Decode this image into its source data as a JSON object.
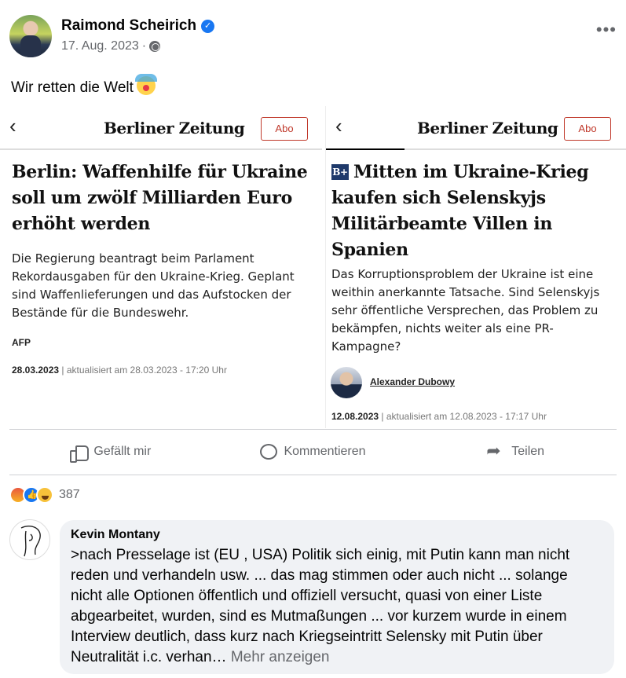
{
  "post": {
    "author": "Raimond Scheirich",
    "date": "17. Aug. 2023",
    "separator": "·",
    "text": "Wir retten die Welt"
  },
  "article_left": {
    "logo": "Berliner Zeitung",
    "abo": "Abo",
    "headline": "Berlin: Waffenhilfe für Ukraine soll um zwölf Milliarden Euro erhöht werden",
    "lede": "Die Regierung beantragt beim Parlament Rekordausgaben für den Ukraine-Krieg. Geplant sind Waffenlieferungen und das Aufstocken der Bestände für die Bundeswehr.",
    "source": "AFP",
    "date": "28.03.2023",
    "updated": "| aktualisiert am 28.03.2023 - 17:20 Uhr"
  },
  "article_right": {
    "logo": "Berliner Zeitung",
    "abo": "Abo",
    "badge": "B+",
    "headline": "Mitten im Ukraine-Krieg kaufen sich Selenskyjs Militärbeamte Villen in Spanien",
    "lede": "Das Korruptionsproblem der Ukraine ist eine weithin anerkannte Tatsache. Sind Selenskyjs sehr öffentliche Versprechen, das Problem zu bekämpfen, nichts weiter als eine PR-Kampagne?",
    "author": "Alexander Dubowy",
    "date": "12.08.2023",
    "updated": "| aktualisiert am 12.08.2023 - 17:17 Uhr"
  },
  "actions": {
    "like": "Gefällt mir",
    "comment": "Kommentieren",
    "share": "Teilen"
  },
  "reactions": {
    "count": "387",
    "types": [
      "angry",
      "like",
      "haha"
    ]
  },
  "comment": {
    "author": "Kevin Montany",
    "text": ">nach Presselage ist (EU , USA) Politik sich einig, mit Putin kann man nicht reden und  verhandeln  usw. ... das mag stimmen oder auch nicht ... solange nicht alle Optionen öffentlich und offiziell versucht, quasi von einer Liste abgearbeitet, wurden, sind es  Mutmaßungen ... vor kurzem wurde in einem Interview deutlich, dass kurz nach Kriegseintritt Selensky mit Putin über Neutralität i.c. verhan…",
    "more": "Mehr anzeigen"
  },
  "colors": {
    "facebook_blue": "#1877f2",
    "muted_text": "#65676b",
    "bubble_bg": "#f0f2f5",
    "abo_red": "#c0392b"
  }
}
